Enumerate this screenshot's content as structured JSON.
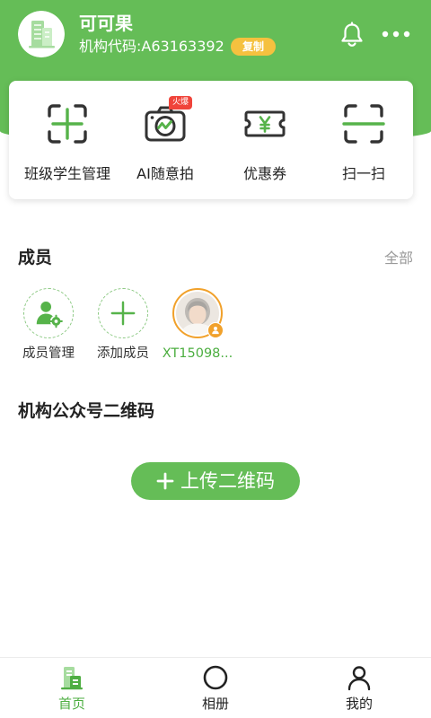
{
  "header": {
    "avatar_icon": "building-icon",
    "org_name": "可可果",
    "org_code": "机构代码:A63163392",
    "copy_label": "复制",
    "notification_icon": "bell-icon",
    "more_icon": "more-icon"
  },
  "quick_actions": [
    {
      "label": "班级学生管理",
      "icon": "class-student-management-icon"
    },
    {
      "label": "AI随意拍",
      "icon": "camera-icon",
      "badge": "火爆"
    },
    {
      "label": "优惠券",
      "icon": "coupon-icon"
    },
    {
      "label": "扫一扫",
      "icon": "scan-icon"
    }
  ],
  "members": {
    "title": "成员",
    "all_label": "全部",
    "items": [
      {
        "label": "成员管理",
        "icon": "member-manage-icon"
      },
      {
        "label": "添加成员",
        "icon": "plus-icon"
      },
      {
        "label": "XT15098...",
        "icon": "user-avatar"
      }
    ]
  },
  "qr_section": {
    "title": "机构公众号二维码",
    "upload_label": "上传二维码",
    "upload_icon": "plus-icon"
  },
  "tabbar": [
    {
      "label": "首页",
      "icon": "home-building-icon",
      "active": true
    },
    {
      "label": "相册",
      "icon": "album-circle-icon",
      "active": false
    },
    {
      "label": "我的",
      "icon": "profile-icon",
      "active": false
    }
  ],
  "colors": {
    "primary": "#65bd57",
    "copy_badge": "#f5c13f",
    "hot_badge": "#f0443a",
    "avatar_ring": "#f1a12b",
    "text_dark": "#222222",
    "text_muted": "#999999"
  }
}
